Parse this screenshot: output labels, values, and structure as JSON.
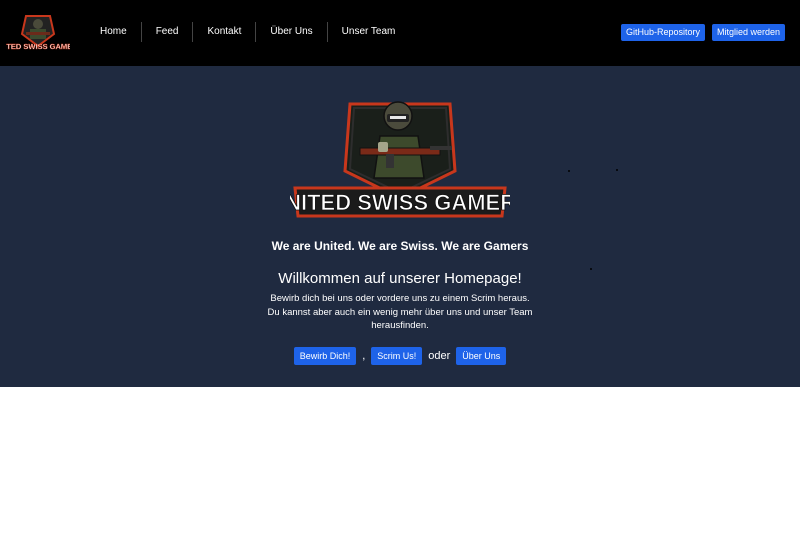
{
  "nav": {
    "logo_text": "UNITED SWISS GAMERS",
    "links": [
      "Home",
      "Feed",
      "Kontakt",
      "Über Uns",
      "Unser Team"
    ],
    "github_label": "GitHub-Repository",
    "join_label": "Mitglied werden"
  },
  "hero": {
    "logo_text": "UNITED SWISS GAMERS",
    "tagline": "We are United. We are Swiss. We are Gamers",
    "welcome": "Willkommen auf unserer Homepage!",
    "description": "Bewirb dich bei uns oder vordere uns zu einem Scrim heraus. Du kannst aber auch ein wenig mehr über uns und unser Team herausfinden.",
    "cta": {
      "apply_label": "Bewirb Dich!",
      "separator_1": ",",
      "scrim_label": "Scrim Us!",
      "separator_2": "oder",
      "about_label": "Über Uns"
    }
  },
  "colors": {
    "navbar_bg": "#000000",
    "hero_bg": "#1f2a40",
    "button": "#1e63e9",
    "logo_red": "#d63b1f"
  }
}
